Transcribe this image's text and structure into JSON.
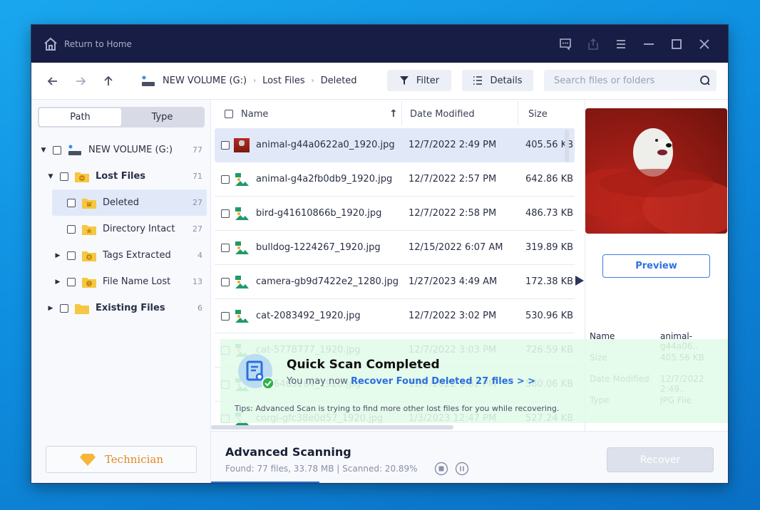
{
  "titlebar": {
    "home_label": "Return to Home",
    "controls": [
      "feedback-icon",
      "share-icon",
      "menu-icon",
      "minimize-icon",
      "maximize-icon",
      "close-icon"
    ]
  },
  "toolbar": {
    "breadcrumb": [
      "NEW VOLUME (G:)",
      "Lost Files",
      "Deleted"
    ],
    "filter_label": "Filter",
    "details_label": "Details",
    "search_placeholder": "Search files or folders",
    "search_value": ""
  },
  "sidebar": {
    "tabs": [
      "Path",
      "Type"
    ],
    "active_tab": "Path",
    "tree": [
      {
        "label": "NEW VOLUME (G:)",
        "count": "77",
        "icon": "drive-icon",
        "expanded": true
      },
      {
        "label": "Lost Files",
        "count": "71",
        "icon": "folder-lost-icon",
        "expanded": true
      },
      {
        "label": "Deleted",
        "count": "27",
        "icon": "folder-deleted-icon",
        "selected": true
      },
      {
        "label": "Directory Intact",
        "count": "27",
        "icon": "folder-star-icon"
      },
      {
        "label": "Tags Extracted",
        "count": "4",
        "icon": "folder-tag-icon"
      },
      {
        "label": "File Name Lost",
        "count": "13",
        "icon": "folder-question-icon"
      },
      {
        "label": "Existing Files",
        "count": "6",
        "icon": "folder-icon"
      }
    ],
    "technician_label": "Technician"
  },
  "filelist": {
    "columns": {
      "name": "Name",
      "date": "Date Modified",
      "size": "Size"
    },
    "sort": "name-ascending",
    "rows": [
      {
        "name": "animal-g44a0622a0_1920.jpg",
        "date": "12/7/2022 2:49 PM",
        "size": "405.56 KB",
        "selected": true
      },
      {
        "name": "animal-g4a2fb0db9_1920.jpg",
        "date": "12/7/2022 2:57 PM",
        "size": "642.86 KB"
      },
      {
        "name": "bird-g41610866b_1920.jpg",
        "date": "12/7/2022 2:58 PM",
        "size": "486.73 KB"
      },
      {
        "name": "bulldog-1224267_1920.jpg",
        "date": "12/15/2022 6:07 AM",
        "size": "319.89 KB"
      },
      {
        "name": "camera-gb9d7422e2_1280.jpg",
        "date": "1/27/2023 4:49 AM",
        "size": "172.38 KB"
      },
      {
        "name": "cat-2083492_1920.jpg",
        "date": "12/7/2022 3:02 PM",
        "size": "530.96 KB"
      },
      {
        "name": "cat-5778777_1920.jpg",
        "date": "12/7/2022 3:03 PM",
        "size": "726.59 KB"
      },
      {
        "name": "cat-6465264_1920.jpg",
        "date": "12/7/2022 3:02 PM",
        "size": "580.06 KB"
      },
      {
        "name": "corgi-gfc38e0d57_1920.jpg",
        "date": "1/3/2023 12:47 PM",
        "size": "527.24 KB"
      }
    ]
  },
  "details": {
    "preview_label": "Preview",
    "fields": [
      {
        "label": "Name",
        "value": "animal-g44a06.."
      },
      {
        "label": "Size",
        "value": "405.56 KB"
      },
      {
        "label": "Date Modified",
        "value": "12/7/2022 2:49.."
      },
      {
        "label": "Type",
        "value": "JPG File"
      }
    ]
  },
  "banner": {
    "title": "Quick Scan Completed",
    "prefix": "You may now",
    "link": "Recover Found Deleted 27 files > >",
    "tips": "Tips: Advanced Scan is trying to find more other lost files for you while recovering."
  },
  "status": {
    "title": "Advanced Scanning",
    "stats": "Found: 77 files, 33.78 MB  |  Scanned: 20.89%",
    "scanned_percent": 20.89,
    "recover_label": "Recover"
  },
  "colors": {
    "titlebar": "#171d45",
    "accent": "#2a6fe0",
    "selection": "#e1e9f9",
    "banner": "#e1fae8",
    "technician": "#e08a2a"
  }
}
